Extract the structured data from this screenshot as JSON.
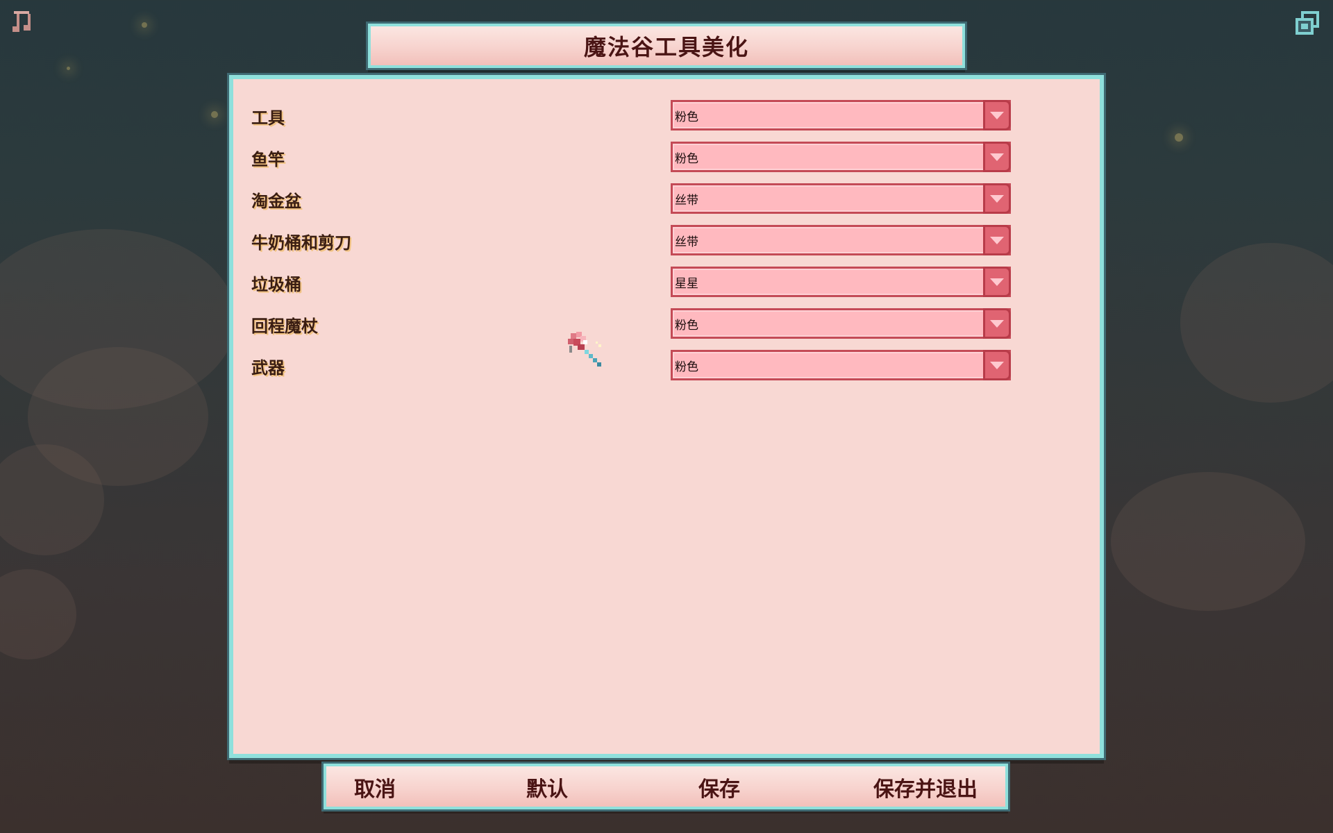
{
  "title": "魔法谷工具美化",
  "settings": [
    {
      "label": "工具",
      "value": "粉色"
    },
    {
      "label": "鱼竿",
      "value": "粉色"
    },
    {
      "label": "淘金盆",
      "value": "丝带"
    },
    {
      "label": "牛奶桶和剪刀",
      "value": "丝带"
    },
    {
      "label": "垃圾桶",
      "value": "星星"
    },
    {
      "label": "回程魔杖",
      "value": "粉色"
    },
    {
      "label": "武器",
      "value": "粉色"
    }
  ],
  "buttons": {
    "cancel": "取消",
    "default": "默认",
    "save": "保存",
    "save_exit": "保存并退出"
  },
  "icons": {
    "music": "music-note-icon",
    "window": "window-mode-icon",
    "preview": "wand-preview-icon"
  },
  "colors": {
    "panel_bg": "#f8d8d3",
    "panel_border": "#8fe0dc",
    "dropdown_bg": "#ffb9bf",
    "dropdown_border": "#c44a56",
    "title_text": "#4a1414"
  }
}
